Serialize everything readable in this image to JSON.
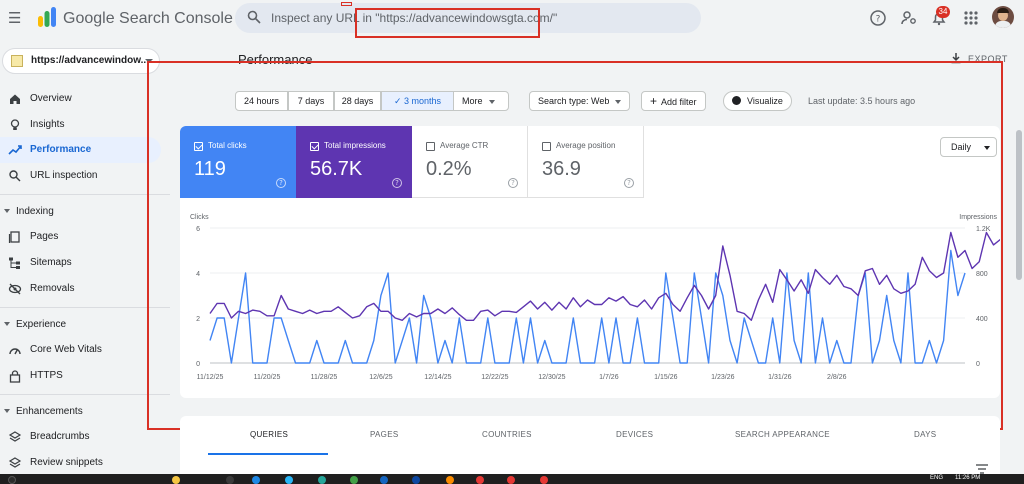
{
  "app": {
    "name": "Google Search Console"
  },
  "search": {
    "placeholder": "Inspect any URL in \"https://advancewindowsgta.com/\""
  },
  "header": {
    "notification_count": "34"
  },
  "sidebar": {
    "property": "https://advancewindow...",
    "items": [
      {
        "label": "Overview",
        "icon": "home-icon"
      },
      {
        "label": "Insights",
        "icon": "lightbulb-icon"
      },
      {
        "label": "Performance",
        "icon": "trending-icon",
        "active": true
      },
      {
        "label": "URL inspection",
        "icon": "search-icon"
      }
    ],
    "sections": [
      {
        "title": "Indexing",
        "items": [
          {
            "label": "Pages",
            "icon": "pages-icon"
          },
          {
            "label": "Sitemaps",
            "icon": "sitemap-icon"
          },
          {
            "label": "Removals",
            "icon": "visibility-off-icon"
          }
        ]
      },
      {
        "title": "Experience",
        "items": [
          {
            "label": "Core Web Vitals",
            "icon": "speed-icon"
          },
          {
            "label": "HTTPS",
            "icon": "lock-icon"
          }
        ]
      },
      {
        "title": "Enhancements",
        "items": [
          {
            "label": "Breadcrumbs",
            "icon": "layers-icon"
          },
          {
            "label": "Review snippets",
            "icon": "layers-icon"
          }
        ]
      }
    ]
  },
  "main": {
    "title": "Performance",
    "export_label": "EXPORT",
    "date_ranges": [
      "24 hours",
      "7 days",
      "28 days",
      "3 months",
      "More"
    ],
    "selected_range": "3 months",
    "search_type": "Search type: Web",
    "add_filter": "Add filter",
    "visualize": "Visualize",
    "last_update": "Last update: 3.5 hours ago",
    "metrics": [
      {
        "label": "Total clicks",
        "value": "119",
        "checked": true,
        "color": "#4285f4"
      },
      {
        "label": "Total impressions",
        "value": "56.7K",
        "checked": true,
        "color": "#5e35b1"
      },
      {
        "label": "Average CTR",
        "value": "0.2%",
        "checked": false
      },
      {
        "label": "Average position",
        "value": "36.9",
        "checked": false
      }
    ],
    "granularity": "Daily",
    "tabs": [
      "QUERIES",
      "PAGES",
      "COUNTRIES",
      "DEVICES",
      "SEARCH APPEARANCE",
      "DAYS"
    ],
    "active_tab": "QUERIES"
  },
  "taskbar": {
    "lang": "ENG",
    "time": "11:26 PM"
  },
  "colors": {
    "accent": "#1a73e8",
    "clicks": "#4285f4",
    "impressions": "#5e35b1",
    "annotation": "#d93025"
  },
  "chart_data": {
    "type": "line",
    "ylabel_left": "Clicks",
    "ylabel_right": "Impressions",
    "y_left_ticks": [
      "6",
      "4",
      "2",
      "0"
    ],
    "y_right_ticks": [
      "1.2K",
      "800",
      "400",
      "0"
    ],
    "ylim_left": [
      0,
      6
    ],
    "ylim_right": [
      0,
      1200
    ],
    "x_ticks": [
      "11/12/25",
      "11/20/25",
      "11/28/25",
      "12/6/25",
      "12/14/25",
      "12/22/25",
      "12/30/25",
      "1/7/26",
      "1/15/26",
      "1/23/26",
      "1/31/26",
      "2/8/26"
    ],
    "x_start": "2025-11-12",
    "series": [
      {
        "name": "Clicks",
        "axis": "left",
        "values": [
          1,
          2,
          2,
          0,
          2,
          4,
          0,
          0,
          0,
          2,
          2,
          1,
          0,
          0,
          0,
          1,
          0,
          0,
          0,
          1,
          0,
          0,
          0,
          1,
          3,
          4,
          0,
          1,
          2,
          0,
          3,
          2,
          0,
          1,
          0,
          2,
          0,
          0,
          0,
          2,
          0,
          0,
          0,
          2,
          0,
          2,
          0,
          1,
          0,
          0,
          0,
          2,
          0,
          0,
          0,
          2,
          0,
          2,
          0,
          0,
          2,
          0,
          0,
          0,
          4,
          2,
          0,
          0,
          4,
          2,
          0,
          4,
          3,
          1,
          0,
          2,
          1,
          0,
          0,
          2,
          0,
          4,
          1,
          0,
          4,
          0,
          2,
          0,
          1,
          0,
          0,
          3,
          4,
          0,
          1,
          3,
          1,
          0,
          4,
          0,
          0,
          1,
          0,
          1,
          5,
          3,
          4
        ]
      },
      {
        "name": "Impressions",
        "axis": "right",
        "values": [
          440,
          530,
          530,
          400,
          460,
          440,
          470,
          460,
          420,
          420,
          600,
          480,
          460,
          440,
          470,
          440,
          460,
          460,
          500,
          450,
          400,
          420,
          500,
          530,
          460,
          460,
          400,
          380,
          440,
          410,
          440,
          440,
          480,
          440,
          490,
          430,
          380,
          380,
          460,
          470,
          420,
          460,
          460,
          450,
          500,
          550,
          480,
          540,
          470,
          540,
          480,
          580,
          500,
          560,
          520,
          520,
          580,
          550,
          590,
          520,
          500,
          560,
          480,
          580,
          620,
          520,
          460,
          580,
          690,
          600,
          480,
          600,
          1040,
          780,
          460,
          440,
          380,
          560,
          700,
          540,
          830,
          740,
          640,
          740,
          620,
          830,
          760,
          700,
          780,
          680,
          660,
          600,
          820,
          840,
          700,
          780,
          660,
          620,
          640,
          700,
          940,
          820,
          760,
          800,
          1160,
          940,
          1000,
          840,
          900,
          1160,
          1050,
          1100
        ]
      }
    ]
  }
}
